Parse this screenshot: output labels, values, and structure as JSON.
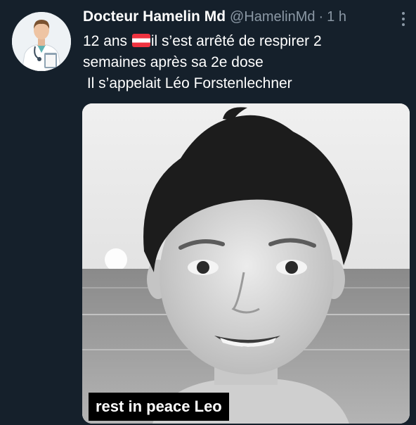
{
  "author": {
    "display_name": "Docteur Hamelin Md",
    "handle": "@HamelinMd",
    "separator": "·",
    "time": "1 h"
  },
  "avatar_icon": "doctor-avatar-icon",
  "more_icon": "more-options-icon",
  "tweet": {
    "line1_before_flag": "12 ans ",
    "flag_icon": "austria-flag-emoji",
    "line1_after_flag": "il s’est arrêté de respirer 2",
    "line2": "semaines après sa 2e dose",
    "line3": " Il s’appelait Léo Forstenlechner"
  },
  "media": {
    "caption": "rest in peace Leo",
    "colors": {
      "sky": "#e2e2e2",
      "sea": "#9a9a9a",
      "hair": "#1c1c1c",
      "skin": "#d8d8d8"
    }
  },
  "colors": {
    "background": "#15202b",
    "text_primary": "#ffffff",
    "text_secondary": "#8b98a5",
    "flag_red": "#ef3340"
  }
}
